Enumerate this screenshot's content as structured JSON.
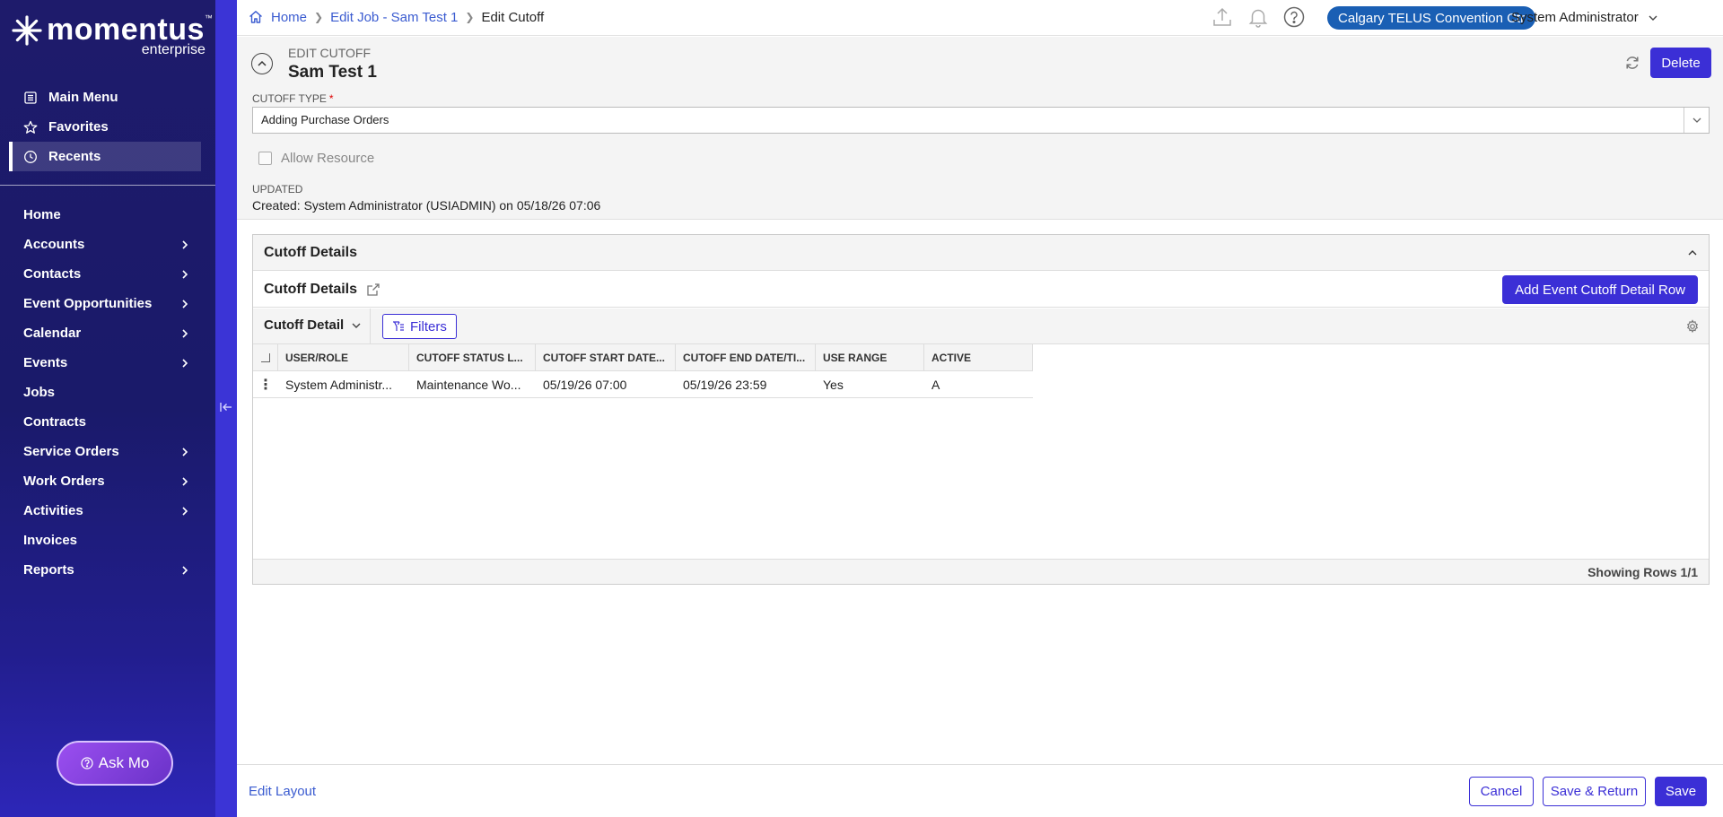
{
  "app": {
    "logo_main": "momentus",
    "logo_tm": "™",
    "logo_sub": "enterprise"
  },
  "sidebar": {
    "quick": [
      {
        "label": "Main Menu",
        "icon": "list-icon"
      },
      {
        "label": "Favorites",
        "icon": "star-icon"
      },
      {
        "label": "Recents",
        "icon": "clock-icon",
        "active": true
      }
    ],
    "nav": [
      {
        "label": "Home",
        "has_children": false
      },
      {
        "label": "Accounts",
        "has_children": true
      },
      {
        "label": "Contacts",
        "has_children": true
      },
      {
        "label": "Event Opportunities",
        "has_children": true
      },
      {
        "label": "Calendar",
        "has_children": true
      },
      {
        "label": "Events",
        "has_children": true
      },
      {
        "label": "Jobs",
        "has_children": false
      },
      {
        "label": "Contracts",
        "has_children": false
      },
      {
        "label": "Service Orders",
        "has_children": true
      },
      {
        "label": "Work Orders",
        "has_children": true
      },
      {
        "label": "Activities",
        "has_children": true
      },
      {
        "label": "Invoices",
        "has_children": false
      },
      {
        "label": "Reports",
        "has_children": true
      }
    ],
    "ask_mo": "Ask Mo"
  },
  "topbar": {
    "breadcrumb": [
      "Home",
      "Edit Job - Sam Test 1",
      "Edit Cutoff"
    ],
    "venue": "Calgary TELUS Convention Ctr",
    "user": "System Administrator"
  },
  "header": {
    "label": "EDIT CUTOFF",
    "title": "Sam Test 1",
    "delete_label": "Delete",
    "cutoff_type_label": "CUTOFF TYPE",
    "required_mark": "*",
    "cutoff_type_value": "Adding Purchase Orders",
    "allow_resource_label": "Allow Resource",
    "allow_resource_checked": false,
    "updated_label": "UPDATED",
    "updated_value": "Created: System Administrator (USIADMIN) on 05/18/26 07:06"
  },
  "panel": {
    "title": "Cutoff Details",
    "sub_title": "Cutoff Details",
    "add_row_label": "Add Event Cutoff Detail Row",
    "view_label": "Cutoff Detail",
    "filters_label": "Filters",
    "columns": [
      "USER/ROLE",
      "CUTOFF STATUS L...",
      "CUTOFF START DATE...",
      "CUTOFF END DATE/TI...",
      "USE RANGE",
      "ACTIVE"
    ],
    "rows": [
      [
        "System Administr...",
        "Maintenance Wo...",
        "05/19/26 07:00",
        "05/19/26 23:59",
        "Yes",
        "A"
      ]
    ],
    "row_count": "Showing Rows 1/1"
  },
  "footer": {
    "edit_layout": "Edit Layout",
    "cancel": "Cancel",
    "save_return": "Save & Return",
    "save": "Save"
  },
  "colors": {
    "sidebar_bg": "#1e1b6b",
    "accent": "#3b2fd6",
    "venue_badge": "#1a5fb4",
    "link": "#3a5bd0"
  }
}
